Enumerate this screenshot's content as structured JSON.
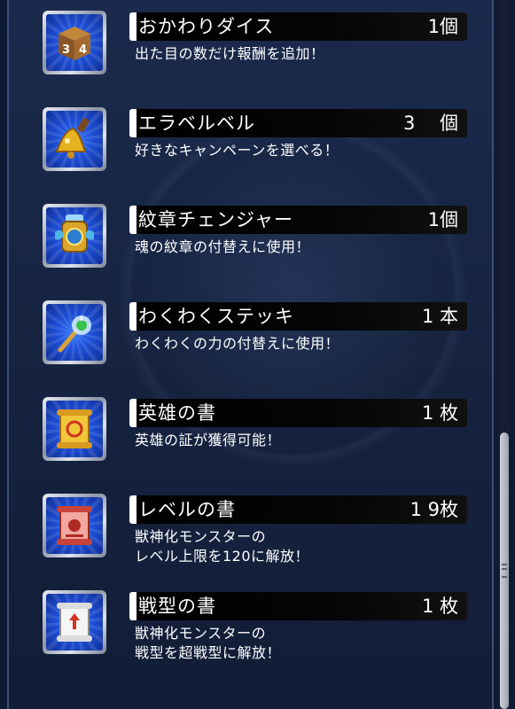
{
  "items": [
    {
      "name": "おかわりダイス",
      "count": "1個",
      "desc": "出た目の数だけ報酬を追加！",
      "icon": "dice-icon"
    },
    {
      "name": "エラベルベル",
      "count": "3　 個",
      "desc": "好きなキャンペーンを選べる！",
      "icon": "bell-icon"
    },
    {
      "name": "紋章チェンジャー",
      "count": "1個",
      "desc": "魂の紋章の付替えに使用！",
      "icon": "emblem-changer-icon"
    },
    {
      "name": "わくわくステッキ",
      "count": "1 本",
      "desc": "わくわくの力の付替えに使用！",
      "icon": "wand-icon"
    },
    {
      "name": "英雄の書",
      "count": "1 枚",
      "desc": "英雄の証が獲得可能！",
      "icon": "gold-scroll-icon"
    },
    {
      "name": "レベルの書",
      "count": "1 9枚",
      "desc": "獣神化モンスターの\nレベル上限を120に解放！",
      "icon": "red-scroll-icon"
    },
    {
      "name": "戦型の書",
      "count": "1 枚",
      "desc": "獣神化モンスターの\n戦型を超戦型に解放！",
      "icon": "white-scroll-icon"
    }
  ],
  "colors": {
    "accent": "#1e4fd6",
    "panel": "#162341",
    "text": "#ffffff"
  }
}
